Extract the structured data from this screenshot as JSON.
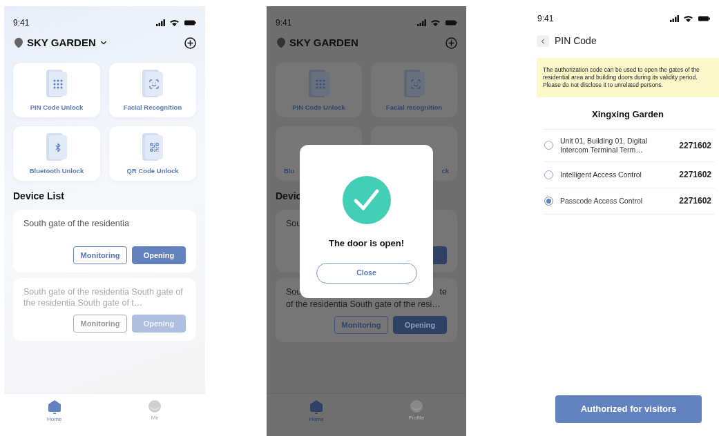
{
  "screens": [
    {
      "kind": "home",
      "status_time": "9:41",
      "location": "SKY GARDEN",
      "location_dropdown": true,
      "tiles": [
        {
          "label": "PIN Code Unlock"
        },
        {
          "label": "Facial Recognition"
        },
        {
          "label": "Bluetooth Unlock"
        },
        {
          "label": "QR Code Unlock"
        }
      ],
      "section_title": "Device List",
      "devices": [
        {
          "name": "South gate of the residentia",
          "enabled": true,
          "buttons": [
            {
              "kind": "outline",
              "label": "Monitoring"
            },
            {
              "kind": "filled",
              "label": "Opening"
            }
          ]
        },
        {
          "name": "South gate of the residentia South gate of the residentia South gate of t…",
          "enabled": false,
          "buttons": [
            {
              "kind": "outline",
              "label": "Monitoring"
            },
            {
              "kind": "filled",
              "label": "Opening"
            }
          ]
        }
      ],
      "nav": [
        {
          "label": "Home",
          "selected": true
        },
        {
          "label": "Me",
          "selected": false
        }
      ]
    },
    {
      "kind": "home",
      "status_time": "9:41",
      "location": "SKY GARDEN",
      "location_dropdown": false,
      "tiles": [
        {
          "label": "PIN Code Unlock"
        },
        {
          "label": "Facial recognition"
        },
        {
          "label": "Blu"
        },
        {
          "label": "ck"
        }
      ],
      "section_title": "Devic",
      "devices": [
        {
          "name": "Sou",
          "enabled": true,
          "buttons": [
            {
              "kind": "filled"
            }
          ]
        },
        {
          "name": "Sou",
          "name_right": "te",
          "name_line2": "of the residentia South gate of the resi…",
          "enabled": true,
          "buttons": [
            {
              "kind": "outline",
              "label": "Monitoring"
            },
            {
              "kind": "filled",
              "label": "Opening"
            }
          ]
        }
      ],
      "nav": [
        {
          "label": "Home",
          "selected": true
        },
        {
          "label": "Profile",
          "selected": false
        }
      ],
      "dialog": {
        "message": "The door is open!",
        "button": "Close"
      }
    },
    {
      "kind": "pin_code",
      "status_time": "9:41",
      "title": "PIN Code",
      "notice": "The authorization code can be used to open the gates of the residential area and building doors during its validity period. Please do not disclose it to unrelated persons.",
      "community": "Xingxing Garden",
      "options": [
        {
          "label": "Unit 01, Building 01, Digital Intercom Terminal Term…",
          "code": "2271602",
          "selected": false
        },
        {
          "label": "Intelligent Access Control",
          "code": "2271602",
          "selected": false
        },
        {
          "label": "Passcode Access Control",
          "code": "2271602",
          "selected": true
        }
      ],
      "action": "Authorized for visitors"
    }
  ]
}
